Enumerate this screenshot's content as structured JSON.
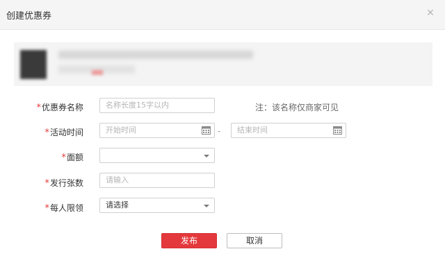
{
  "dialog": {
    "title": "创建优惠券",
    "close_icon": "close-icon"
  },
  "form": {
    "coupon_name": {
      "label": "优惠券名称",
      "placeholder": "名称长度15字以内",
      "value": ""
    },
    "note": "注：该名称仅商家可见",
    "activity_time": {
      "label": "活动时间",
      "start_placeholder": "开始时间",
      "separator": "-",
      "end_placeholder": "结束时间"
    },
    "face_value": {
      "label": "面额",
      "selected": ""
    },
    "issue_count": {
      "label": "发行张数",
      "placeholder": "请输入"
    },
    "per_person_limit": {
      "label": "每人限领",
      "selected": "请选择"
    },
    "required_marker": "*"
  },
  "buttons": {
    "publish": "发布",
    "cancel": "取消"
  },
  "colors": {
    "accent": "#e4393c",
    "title_bar_bg": "#f5f5f5",
    "border": "#cfcfcf"
  }
}
